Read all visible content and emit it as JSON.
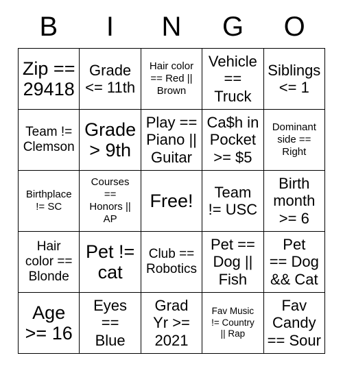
{
  "card": {
    "title": "BINGO",
    "headers": [
      "B",
      "I",
      "N",
      "G",
      "O"
    ],
    "free_space_label": "Free!",
    "rows": [
      [
        {
          "text": "Zip ==\n29418",
          "size": "xl"
        },
        {
          "text": "Grade\n<= 11th",
          "size": "lg"
        },
        {
          "text": "Hair color\n== Red ||\nBrown",
          "size": "sm"
        },
        {
          "text": "Vehicle\n==\nTruck",
          "size": "lg"
        },
        {
          "text": "Siblings\n<= 1",
          "size": "lg"
        }
      ],
      [
        {
          "text": "Team !=\nClemson",
          "size": "md"
        },
        {
          "text": "Grade\n> 9th",
          "size": "xl"
        },
        {
          "text": "Play ==\nPiano ||\nGuitar",
          "size": "lg"
        },
        {
          "text": "Ca$h in\nPocket\n>= $5",
          "size": "lg"
        },
        {
          "text": "Dominant\nside ==\nRight",
          "size": "sm"
        }
      ],
      [
        {
          "text": "Birthplace\n!= SC",
          "size": "sm"
        },
        {
          "text": "Courses\n==\nHonors ||\nAP",
          "size": "sm"
        },
        {
          "text": "Free!",
          "size": "xl",
          "free": true
        },
        {
          "text": "Team\n!= USC",
          "size": "lg"
        },
        {
          "text": "Birth\nmonth\n>= 6",
          "size": "lg"
        }
      ],
      [
        {
          "text": "Hair\ncolor ==\nBlonde",
          "size": "md"
        },
        {
          "text": "Pet !=\ncat",
          "size": "xl"
        },
        {
          "text": "Club ==\nRobotics",
          "size": "md"
        },
        {
          "text": "Pet ==\nDog ||\nFish",
          "size": "lg"
        },
        {
          "text": "Pet\n== Dog\n&& Cat",
          "size": "lg"
        }
      ],
      [
        {
          "text": "Age\n>= 16",
          "size": "xl"
        },
        {
          "text": "Eyes\n==\nBlue",
          "size": "lg"
        },
        {
          "text": "Grad\nYr >=\n2021",
          "size": "lg"
        },
        {
          "text": "Fav Music\n!= Country\n|| Rap",
          "size": "xs"
        },
        {
          "text": "Fav\nCandy\n== Sour",
          "size": "lg"
        }
      ]
    ]
  },
  "colors": {
    "border": "#000000",
    "text": "#000000",
    "background": "#ffffff"
  }
}
